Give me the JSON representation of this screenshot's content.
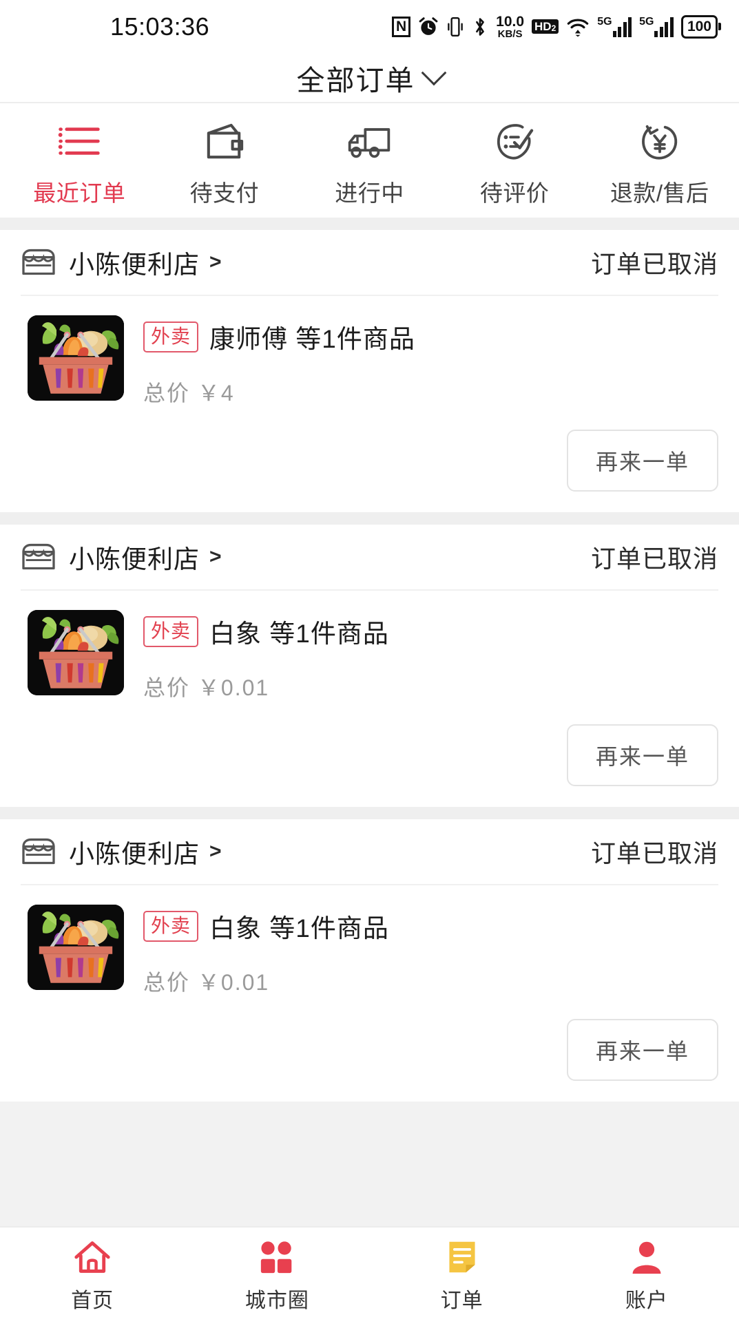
{
  "status_bar": {
    "time": "15:03:36",
    "nfc": "N",
    "net_speed_value": "10.0",
    "net_speed_unit": "KB/S",
    "hd_label": "HD",
    "hd_sub": "2",
    "sim1_net": "5G",
    "sim2_net": "5G",
    "battery": "100",
    "icons": [
      "nfc-icon",
      "alarm-icon",
      "vibrate-icon",
      "bluetooth-icon",
      "network-speed-icon",
      "hd-voice-icon",
      "wifi-icon",
      "signal-icon",
      "signal-icon",
      "battery-icon"
    ]
  },
  "header": {
    "title": "全部订单",
    "dropdown_icon": "chevron-down-icon"
  },
  "tabs": [
    {
      "label": "最近订单",
      "icon": "list-icon",
      "active": true
    },
    {
      "label": "待支付",
      "icon": "wallet-icon",
      "active": false
    },
    {
      "label": "进行中",
      "icon": "truck-icon",
      "active": false
    },
    {
      "label": "待评价",
      "icon": "review-icon",
      "active": false
    },
    {
      "label": "退款/售后",
      "icon": "refund-icon",
      "active": false
    }
  ],
  "orders": [
    {
      "shop": "小陈便利店",
      "shop_arrow": ">",
      "status": "订单已取消",
      "badge": "外卖",
      "product": "康师傅 等1件商品",
      "price_label": "总价",
      "price": "￥4",
      "action": "再来一单"
    },
    {
      "shop": "小陈便利店",
      "shop_arrow": ">",
      "status": "订单已取消",
      "badge": "外卖",
      "product": "白象 等1件商品",
      "price_label": "总价",
      "price": "￥0.01",
      "action": "再来一单"
    },
    {
      "shop": "小陈便利店",
      "shop_arrow": ">",
      "status": "订单已取消",
      "badge": "外卖",
      "product": "白象 等1件商品",
      "price_label": "总价",
      "price": "￥0.01",
      "action": "再来一单"
    }
  ],
  "bottom_nav": [
    {
      "label": "首页",
      "icon": "home-icon"
    },
    {
      "label": "城市圈",
      "icon": "grid-icon"
    },
    {
      "label": "订单",
      "icon": "order-note-icon"
    },
    {
      "label": "账户",
      "icon": "person-icon"
    }
  ],
  "colors": {
    "accent": "#e23a50",
    "badge": "#e2414f",
    "order_icon": "#f5c542",
    "page_bg": "#f2f2f2"
  }
}
